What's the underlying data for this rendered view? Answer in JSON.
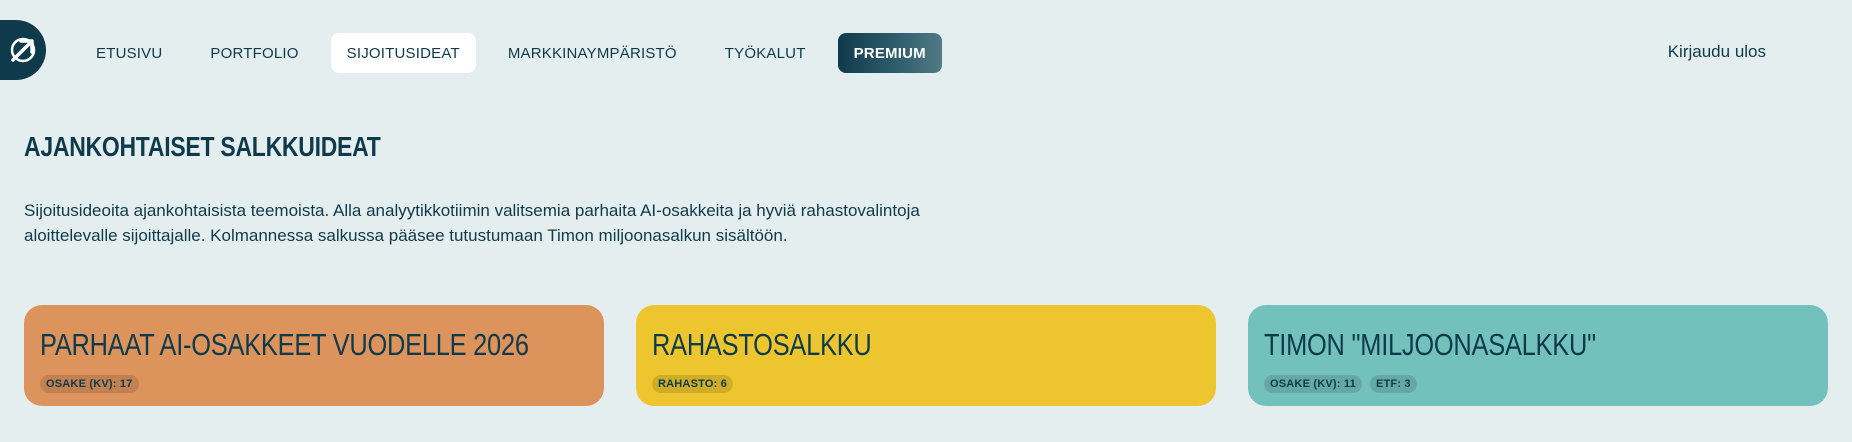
{
  "colors": {
    "background": "#e5eeef",
    "primary": "#0f3a4b",
    "card_orange": "#dc935c",
    "card_yellow": "#ecc52f",
    "card_teal": "#73c1bd"
  },
  "header": {
    "logo_icon": "arrow-up-right-icon",
    "nav": [
      {
        "label": "ETUSIVU"
      },
      {
        "label": "PORTFOLIO"
      },
      {
        "label": "SIJOITUSIDEAT"
      },
      {
        "label": "MARKKINAYMPÄRISTÖ"
      },
      {
        "label": "TYÖKALUT"
      },
      {
        "label": "PREMIUM"
      }
    ],
    "active_nav": "SIJOITUSIDEAT",
    "logout_label": "Kirjaudu ulos"
  },
  "main": {
    "title": "AJANKOHTAISET SALKKUIDEAT",
    "intro": "Sijoitusideoita ajankohtaisista teemoista. Alla analyytikkotiimin valitsemia parhaita AI-osakkeita ja hyviä rahastovalintoja aloittelevalle sijoittajalle. Kolmannessa salkussa pääsee tutustumaan Timon miljoonasalkun sisältöön.",
    "cards": [
      {
        "title": "PARHAAT AI-OSAKKEET VUODELLE 2026",
        "color": "#dc935c",
        "badges": [
          "OSAKE (KV): 17"
        ]
      },
      {
        "title": "RAHASTOSALKKU",
        "color": "#ecc52f",
        "badges": [
          "RAHASTO: 6"
        ]
      },
      {
        "title": "TIMON \"MILJOONASALKKU\"",
        "color": "#73c1bd",
        "badges": [
          "OSAKE (KV): 11",
          "ETF: 3"
        ]
      }
    ]
  }
}
